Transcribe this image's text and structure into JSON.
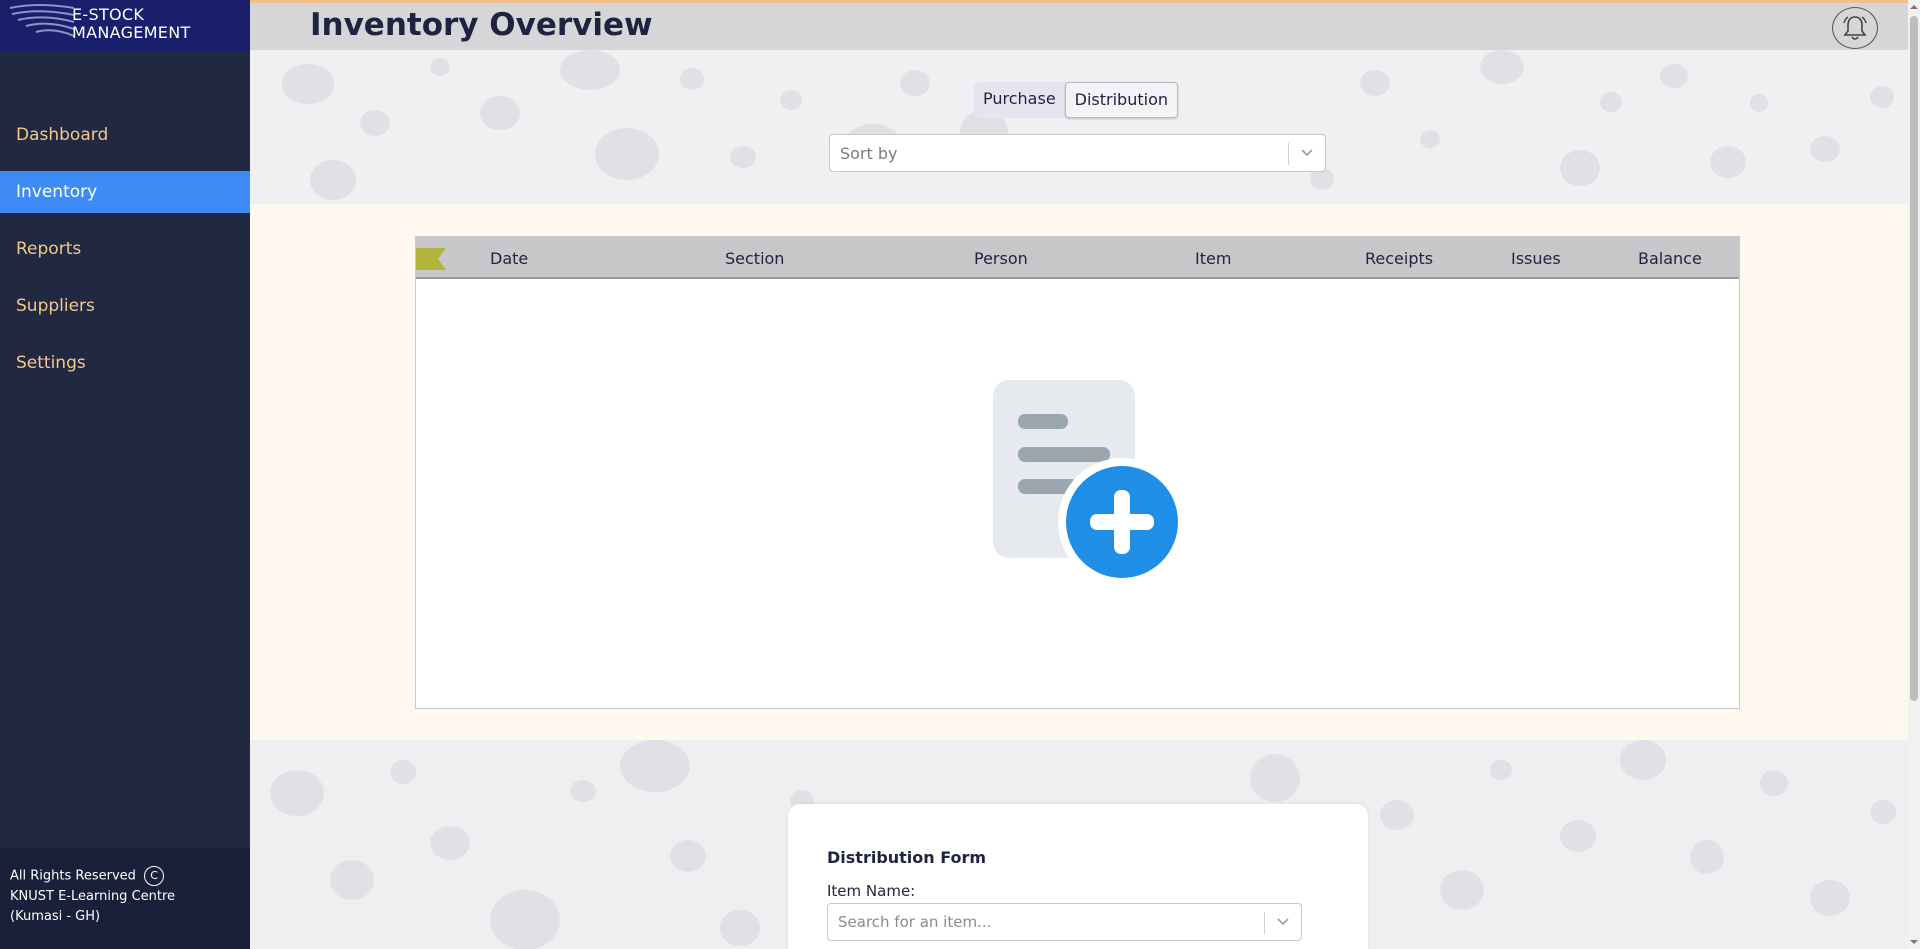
{
  "app": {
    "logo_line1": "E-STOCK",
    "logo_line2": "MANAGEMENT",
    "brand_color": "#1a1f6b",
    "accent_color": "#3d8cf5"
  },
  "sidebar": {
    "items": [
      {
        "label": "Dashboard",
        "active": false
      },
      {
        "label": "Inventory",
        "active": true
      },
      {
        "label": "Reports",
        "active": false
      },
      {
        "label": "Suppliers",
        "active": false
      },
      {
        "label": "Settings",
        "active": false
      }
    ],
    "footer": {
      "rights": "All Rights Reserved",
      "copyright_symbol": "C",
      "org": "KNUST E-Learning Centre",
      "location": "(Kumasi - GH)"
    }
  },
  "header": {
    "title": "Inventory Overview",
    "notification_icon": "bell-icon"
  },
  "toggle": {
    "options": [
      "Purchase",
      "Distribution"
    ],
    "selected": "Distribution"
  },
  "sort": {
    "placeholder": "Sort by",
    "icon": "chevron-down-icon"
  },
  "table": {
    "columns": [
      "Date",
      "Section",
      "Person",
      "Item",
      "Receipts",
      "Issues",
      "Balance"
    ],
    "rows": [],
    "empty_icon": "add-document-icon"
  },
  "form": {
    "title": "Distribution Form",
    "item_label": "Item Name:",
    "item_placeholder": "Search for an item..."
  }
}
